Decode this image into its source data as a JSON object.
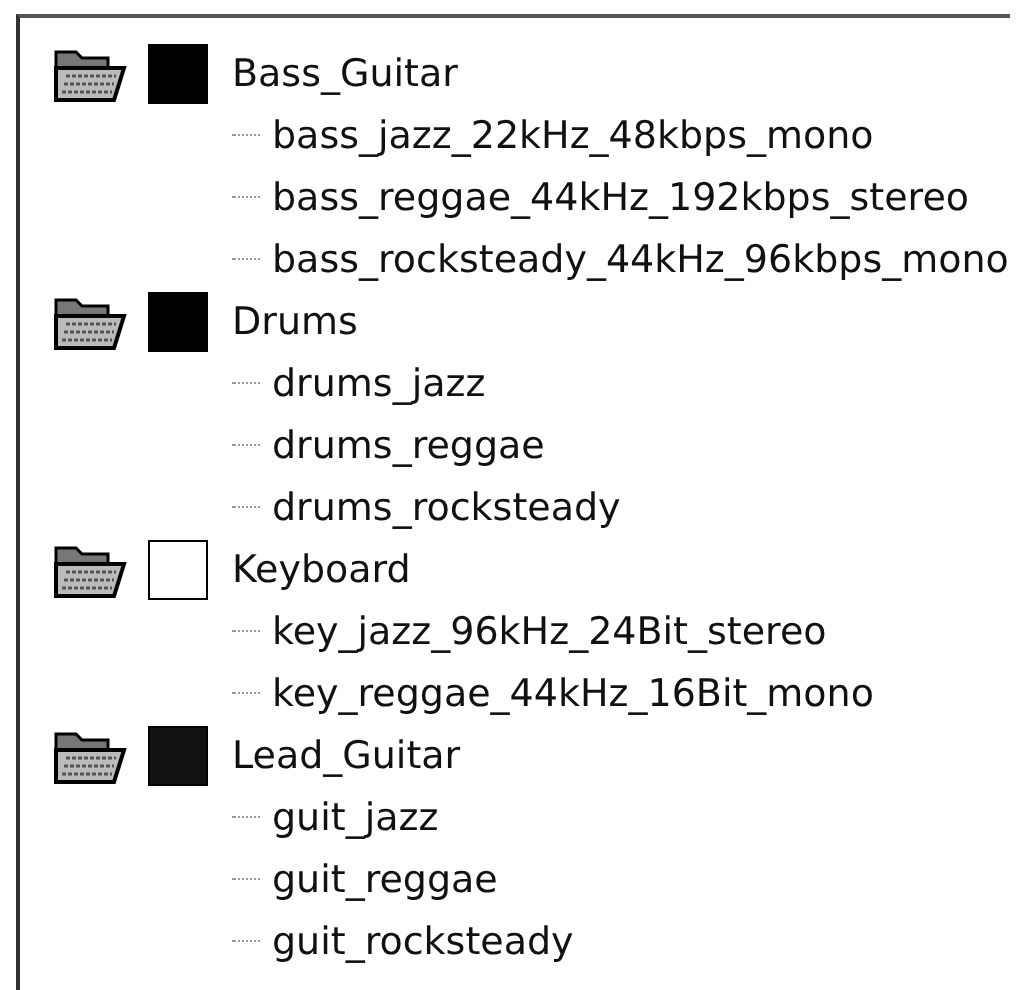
{
  "tree": [
    {
      "label": "Bass_Guitar",
      "color": "#000000",
      "children": [
        {
          "label": "bass_jazz_22kHz_48kbps_mono"
        },
        {
          "label": "bass_reggae_44kHz_192kbps_stereo"
        },
        {
          "label": "bass_rocksteady_44kHz_96kbps_mono"
        }
      ]
    },
    {
      "label": "Drums",
      "color": "#000000",
      "children": [
        {
          "label": "drums_jazz"
        },
        {
          "label": "drums_reggae"
        },
        {
          "label": "drums_rocksteady"
        }
      ]
    },
    {
      "label": "Keyboard",
      "color": "#ffffff",
      "children": [
        {
          "label": "key_jazz_96kHz_24Bit_stereo"
        },
        {
          "label": "key_reggae_44kHz_16Bit_mono"
        }
      ]
    },
    {
      "label": "Lead_Guitar",
      "color": "#111111",
      "children": [
        {
          "label": "guit_jazz"
        },
        {
          "label": "guit_reggae"
        },
        {
          "label": "guit_rocksteady"
        }
      ]
    }
  ]
}
